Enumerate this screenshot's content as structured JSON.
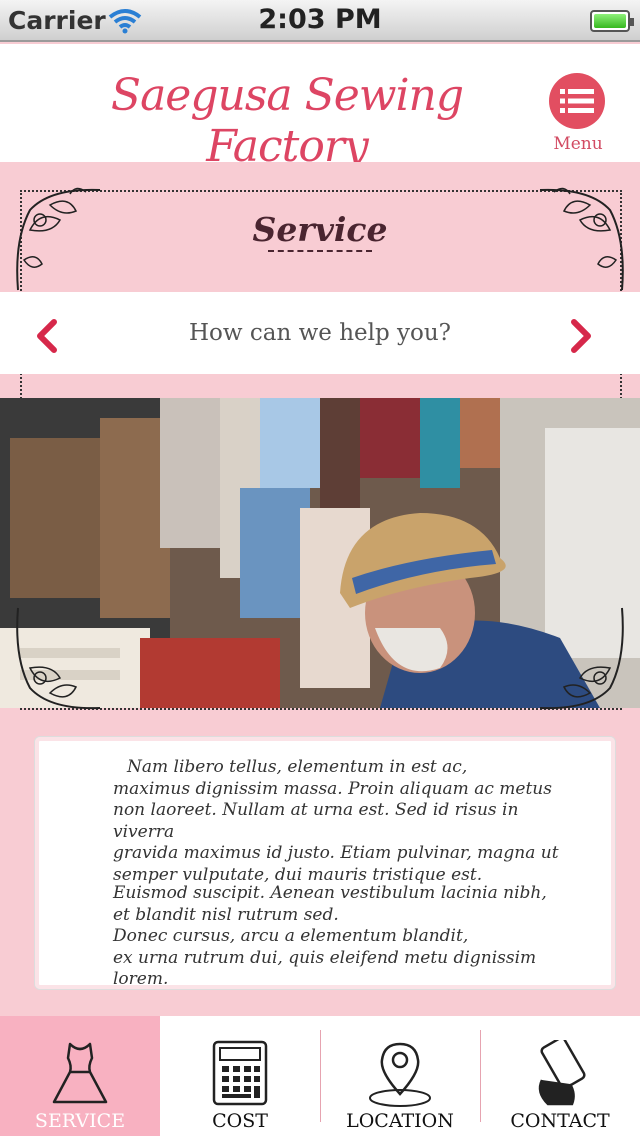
{
  "status_bar": {
    "carrier": "Carrier",
    "time": "2:03 PM",
    "wifi_icon": "wifi-icon",
    "battery_icon": "battery-icon"
  },
  "header": {
    "brand": "Saegusa Sewing Factory",
    "menu_label": "Menu",
    "menu_icon": "list-icon"
  },
  "section": {
    "title": "Service"
  },
  "slider": {
    "text": "How can we help you?",
    "prev_icon": "chevron-left-icon",
    "next_icon": "chevron-right-icon"
  },
  "body_text": {
    "paragraph1": [
      "Nam libero tellus, elementum in est ac,",
      "maximus dignissim massa. Proin aliquam ac metus",
      "non laoreet. Nullam at urna est. Sed id risus in viverra",
      "gravida maximus id justo. Etiam pulvinar, magna ut",
      "semper vulputate, dui mauris tristique est."
    ],
    "paragraph2": [
      "Euismod suscipit. Aenean vestibulum lacinia nibh,",
      "et blandit nisl rutrum sed.",
      "Donec cursus, arcu a elementum blandit,",
      "ex urna rutrum dui, quis eleifend metu dignissim lorem."
    ]
  },
  "tabs": [
    {
      "label": "SERVICE",
      "icon": "dress-icon",
      "active": true
    },
    {
      "label": "COST",
      "icon": "calculator-icon",
      "active": false
    },
    {
      "label": "LOCATION",
      "icon": "map-pin-icon",
      "active": false
    },
    {
      "label": "CONTACT",
      "icon": "phone-icon",
      "active": false
    }
  ],
  "colors": {
    "accent": "#dd4563",
    "background_pink": "#f8ccd3",
    "active_tab": "#f8b1c1"
  }
}
